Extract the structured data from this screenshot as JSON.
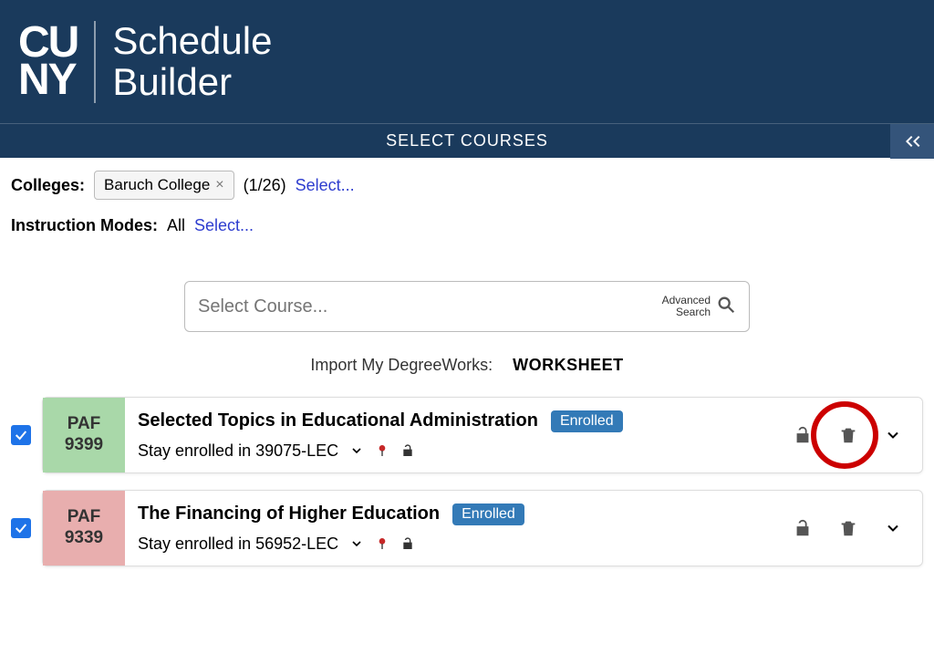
{
  "header": {
    "app_title_line1": "Schedule",
    "app_title_line2": "Builder"
  },
  "subheader": {
    "title": "SELECT COURSES"
  },
  "filters": {
    "colleges_label": "Colleges:",
    "college_chip": "Baruch College",
    "college_count": "(1/26)",
    "college_select": "Select...",
    "modes_label": "Instruction Modes:",
    "modes_value": "All",
    "modes_select": "Select..."
  },
  "search": {
    "placeholder": "Select Course...",
    "advanced_label_line1": "Advanced",
    "advanced_label_line2": "Search",
    "import_label": "Import My DegreeWorks:",
    "worksheet_label": "WORKSHEET"
  },
  "courses": [
    {
      "dept": "PAF",
      "number": "9399",
      "title": "Selected Topics in Educational Administration",
      "status": "Enrolled",
      "stay_text": "Stay enrolled in 39075-LEC",
      "color": "green",
      "highlight_trash": true
    },
    {
      "dept": "PAF",
      "number": "9339",
      "title": "The Financing of Higher Education",
      "status": "Enrolled",
      "stay_text": "Stay enrolled in 56952-LEC",
      "color": "red",
      "highlight_trash": false
    }
  ]
}
